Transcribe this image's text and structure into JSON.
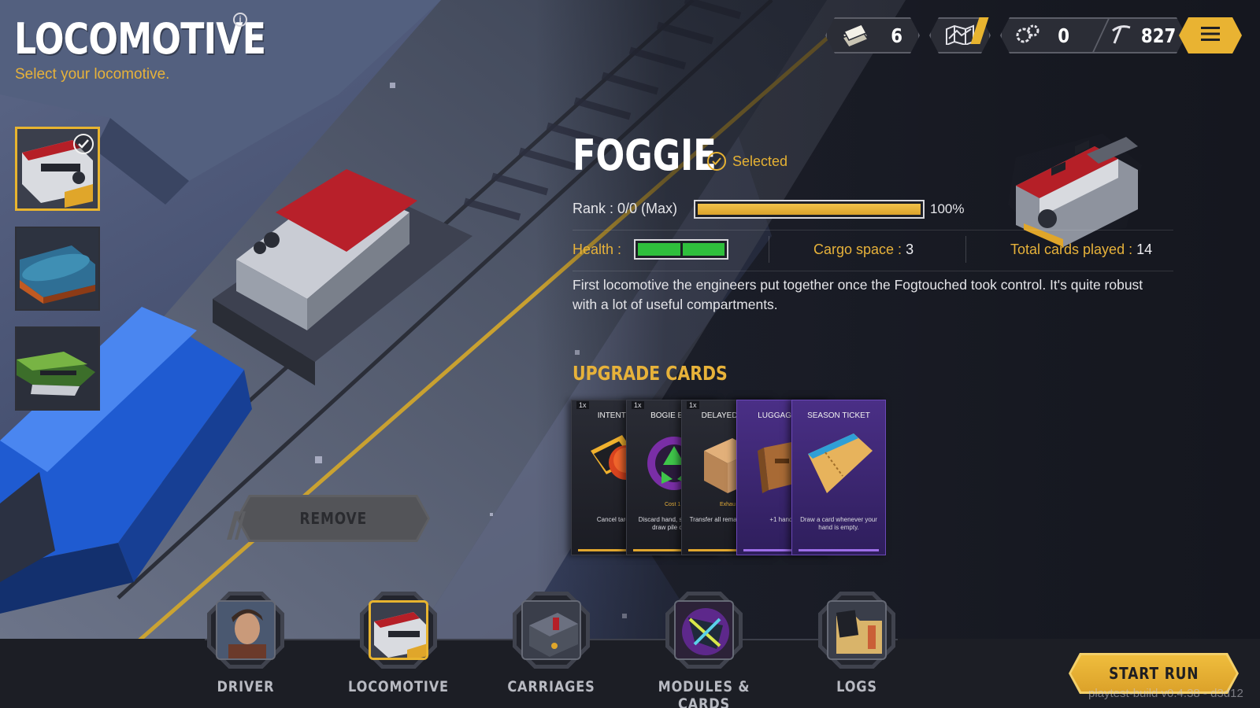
{
  "header": {
    "title": "LOCOMOTIVE",
    "subtitle": "Select your locomotive."
  },
  "resources": {
    "cards_count": "6",
    "gears_count": "0",
    "pick_count": "827"
  },
  "locomotive_list": [
    {
      "name": "Foggie",
      "selected": true
    },
    {
      "name": "Blue steam locomotive",
      "selected": false
    },
    {
      "name": "Green bullet locomotive",
      "selected": false
    }
  ],
  "remove_button": "REMOVE",
  "details": {
    "name": "FOGGIE",
    "selected_label": "Selected",
    "rank_label": "Rank : 0/0 (Max)",
    "rank_progress": 1.0,
    "rank_percent": "100%",
    "health_label": "Health :",
    "health_segments": 2,
    "cargo_label": "Cargo space :",
    "cargo_value": "3",
    "total_label": "Total cards played :",
    "total_value": "14",
    "description": "First locomotive the engineers put together once the Fogtouched took control. It's quite robust with a lot of useful compartments."
  },
  "upgrade_title": "UPGRADE CARDS",
  "cards": [
    {
      "title": "INTENT BU",
      "qty": "1x",
      "cost": "2",
      "desc": "Cancel target u",
      "style": "dark"
    },
    {
      "title": "BOGIE EXCI",
      "qty": "1x",
      "cost": "1",
      "cost_line": "Cost 1",
      "desc": "Discard hand, sh into the draw pile cards",
      "style": "dark"
    },
    {
      "title": "DELAYED DEF",
      "qty": "1x",
      "cost": "1",
      "cost_line": "Exhau",
      "desc": "Transfer all rema next playe",
      "style": "dark"
    },
    {
      "title": "LUGGAGE EX",
      "desc": "+1 hand s",
      "style": "purple"
    },
    {
      "title": "SEASON TICKET",
      "desc": "Draw a card whenever your hand is empty.",
      "style": "purple"
    }
  ],
  "nav": [
    {
      "label": "DRIVER",
      "active": false
    },
    {
      "label": "LOCOMOTIVE",
      "active": true
    },
    {
      "label": "CARRIAGES",
      "active": false
    },
    {
      "label": "MODULES & CARDS",
      "active": false
    },
    {
      "label": "LOGS",
      "active": false
    }
  ],
  "start_button": "START RUN",
  "build_label": "playtest-build v0.4.38 - d3d12",
  "colors": {
    "accent": "#e8b42f",
    "health": "#2fbf3c",
    "panel_bg": "#1c1e25"
  }
}
